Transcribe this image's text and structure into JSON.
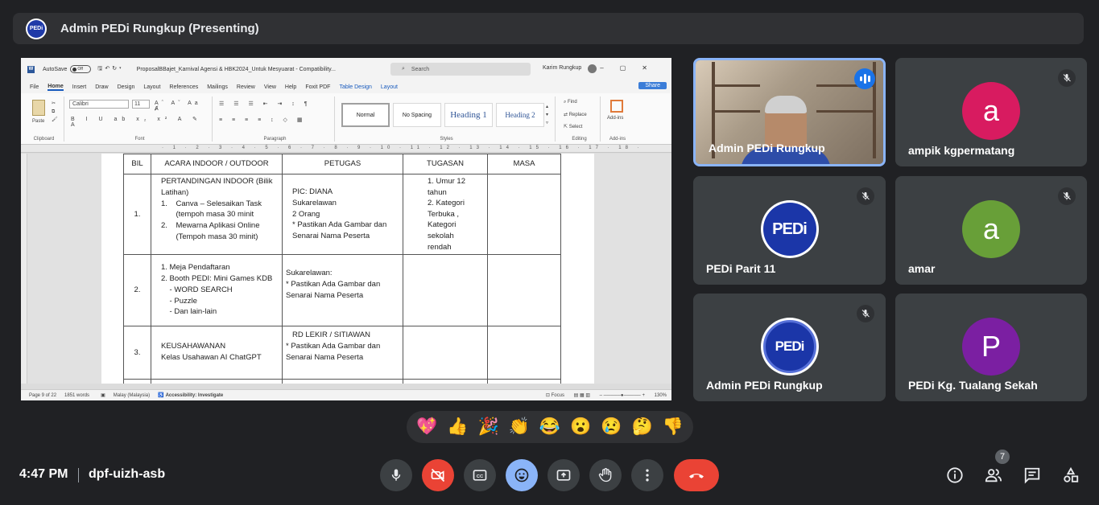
{
  "presenting_bar": {
    "title": "Admin PEDi Rungkup (Presenting)",
    "logo_text": "PEDi"
  },
  "word": {
    "autosave_label": "AutoSave",
    "autosave_state": "Off",
    "doc_name": "ProposalBBajet_Karnival Agensi & HBK2024_Untuk Mesyuarat  -  Compatibility...",
    "search_placeholder": "Search",
    "user_name": "Karim Rungkup",
    "tabs": [
      "File",
      "Home",
      "Insert",
      "Draw",
      "Design",
      "Layout",
      "References",
      "Mailings",
      "Review",
      "View",
      "Help",
      "Foxit PDF",
      "Table Design",
      "Layout"
    ],
    "share_label": "Share",
    "ribbon": {
      "paste_label": "Paste",
      "clipboard_label": "Clipboard",
      "font_name": "Calibri",
      "font_size": "11",
      "font_label": "Font",
      "paragraph_label": "Paragraph",
      "styles_label": "Styles",
      "styles": [
        "Normal",
        "No Spacing",
        "Heading 1",
        "Heading 2"
      ],
      "find_label": "Find",
      "replace_label": "Replace",
      "select_label": "Select",
      "editing_label": "Editing",
      "addins_label": "Add-ins"
    },
    "table": {
      "headers": [
        "BIL",
        "ACARA INDOOR / OUTDOOR",
        "PETUGAS",
        "TUGASAN",
        "MASA"
      ],
      "rows": [
        {
          "bil": "1.",
          "acara": [
            "PERTANDINGAN INDOOR (Bilik Latihan)",
            "1.    Canva – Selesaikan Task",
            "       (tempoh masa 30 minit",
            "2.    Mewarna Aplikasi Online",
            "       (Tempoh masa 30 minit)"
          ],
          "petugas": [
            "PIC: DIANA",
            "Sukarelawan",
            "2 Orang",
            "* Pastikan Ada Gambar dan",
            "Senarai Nama Peserta"
          ],
          "tugasan": [
            "1. Umur 12",
            "tahun",
            "2. Kategori",
            "Terbuka ,",
            "Kategori",
            "sekolah",
            "rendah"
          ],
          "masa": ""
        },
        {
          "bil": "2.",
          "acara": [
            "1. Meja Pendaftaran",
            "2. Booth PEDI: Mini Games KDB",
            "    - WORD SEARCH",
            "    - Puzzle",
            "    - Dan lain-lain"
          ],
          "petugas": [
            "Sukarelawan:",
            "* Pastikan Ada Gambar dan",
            "Senarai Nama Peserta"
          ],
          "tugasan": [],
          "masa": ""
        },
        {
          "bil": "3.",
          "acara": [
            "KEUSAHAWANAN",
            "Kelas Usahawan AI ChatGPT"
          ],
          "petugas": [
            "RD LEKIR / SITIAWAN",
            "* Pastikan Ada Gambar dan",
            "Senarai Nama Peserta"
          ],
          "tugasan": [],
          "masa": ""
        }
      ]
    },
    "status": {
      "page": "Page 9 of 22",
      "words": "1851 words",
      "language": "Malay (Malaysia)",
      "accessibility": "Accessibility: Investigate",
      "focus": "Focus",
      "zoom": "130%"
    }
  },
  "participants": [
    {
      "name": "Admin PEDi Rungkup",
      "type": "video",
      "speaking": true
    },
    {
      "name": "ampik kgpermatang",
      "initial": "a",
      "color": "#d81b60",
      "muted": true
    },
    {
      "name": "PEDi Parit 11",
      "logo": "PEDi",
      "muted": true
    },
    {
      "name": "amar",
      "initial": "a",
      "color": "#689f38",
      "muted": true
    },
    {
      "name": "Admin PEDi Rungkup",
      "logo": "PEDi",
      "muted": true
    },
    {
      "name": "PEDi Kg. Tualang Sekah",
      "initial": "P",
      "color": "#7b1fa2",
      "muted": false
    }
  ],
  "reactions": [
    "💖",
    "👍",
    "🎉",
    "👏",
    "😂",
    "😮",
    "😢",
    "🤔",
    "👎"
  ],
  "meeting": {
    "time": "4:47 PM",
    "code": "dpf-uizh-asb",
    "participant_count": "7"
  },
  "colors": {
    "background": "#202124",
    "tile": "#3c4043",
    "accent": "#8ab4f8",
    "danger": "#ea4335"
  }
}
